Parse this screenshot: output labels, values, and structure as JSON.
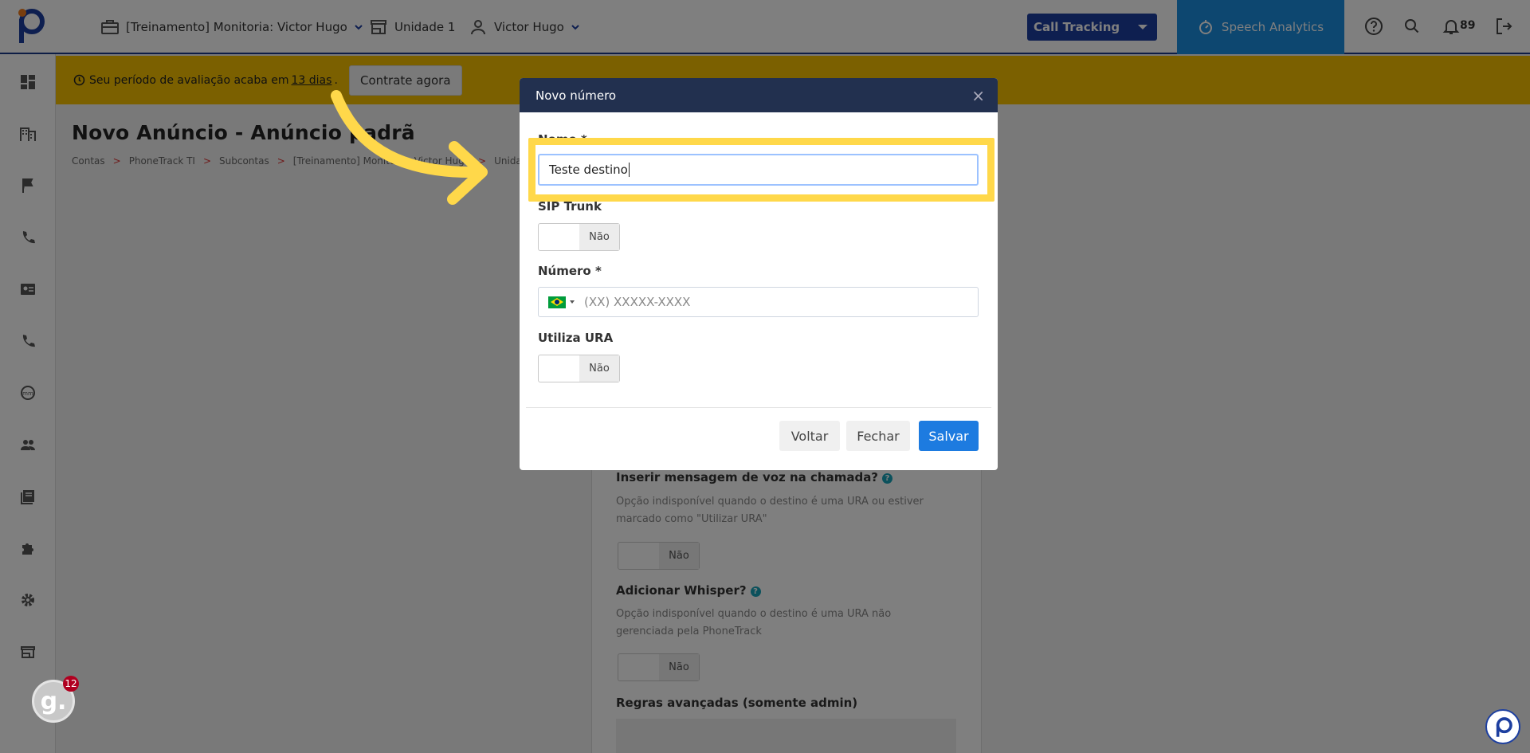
{
  "header": {
    "account_selector": "[Treinamento] Monitoria: Victor Hugo",
    "unit": "Unidade 1",
    "user": "Victor Hugo",
    "product_select": "Call Tracking",
    "speech_analytics": "Speech Analytics",
    "notification_count": "89"
  },
  "banner": {
    "text_before": "Seu período de avaliação acaba em",
    "days": "13 dias",
    "text_after": ".",
    "cta": "Contrate agora"
  },
  "page": {
    "title": "Novo Anúncio - Anúncio padrã",
    "breadcrumb": [
      "Contas",
      ">",
      "PhoneTrack TI",
      ">",
      "Subcontas",
      ">",
      "[Treinamento] Monitoria: Victor Hugo",
      ">",
      "Unidades",
      ">"
    ]
  },
  "background_form": {
    "voice_message_label": "Inserir mensagem de voz na chamada?",
    "voice_message_note": "Opção indisponível quando o destino é uma URA ou estiver marcado como \"Utilizar URA\"",
    "voice_message_toggle": "Não",
    "whisper_label": "Adicionar Whisper?",
    "whisper_note": "Opção indisponível quando o destino é uma URA não gerenciada pela PhoneTrack",
    "whisper_toggle": "Não",
    "advanced_rules_label": "Regras avançadas (somente admin)",
    "help_glyph": "?"
  },
  "modal": {
    "title": "Novo número",
    "close_glyph": "×",
    "name_label": "Nome *",
    "name_value": "Teste destino",
    "sip_trunk_label": "SIP Trunk",
    "sip_trunk_toggle": "Não",
    "number_label": "Número *",
    "number_placeholder": "(XX) XXXXX-XXXX",
    "ura_label": "Utiliza URA",
    "ura_toggle": "Não",
    "back_button": "Voltar",
    "close_button": "Fechar",
    "save_button": "Salvar"
  },
  "widget": {
    "letter": "g.",
    "badge": "12"
  },
  "colors": {
    "brand_blue": "#1d3fa0",
    "speech_blue": "#1b8ee0",
    "banner_yellow": "#f6c000",
    "highlight_yellow": "#ffd84a",
    "modal_header": "#22304f",
    "primary_button": "#1d7be0"
  },
  "icons": {
    "sidebar": [
      "dashboard-icon",
      "building-icon",
      "flag-icon",
      "phone-icon",
      "contact-card-icon",
      "phone-icon",
      "speed-icon",
      "users-icon",
      "book-icon",
      "puzzle-icon",
      "gear-icon",
      "store-icon"
    ]
  }
}
